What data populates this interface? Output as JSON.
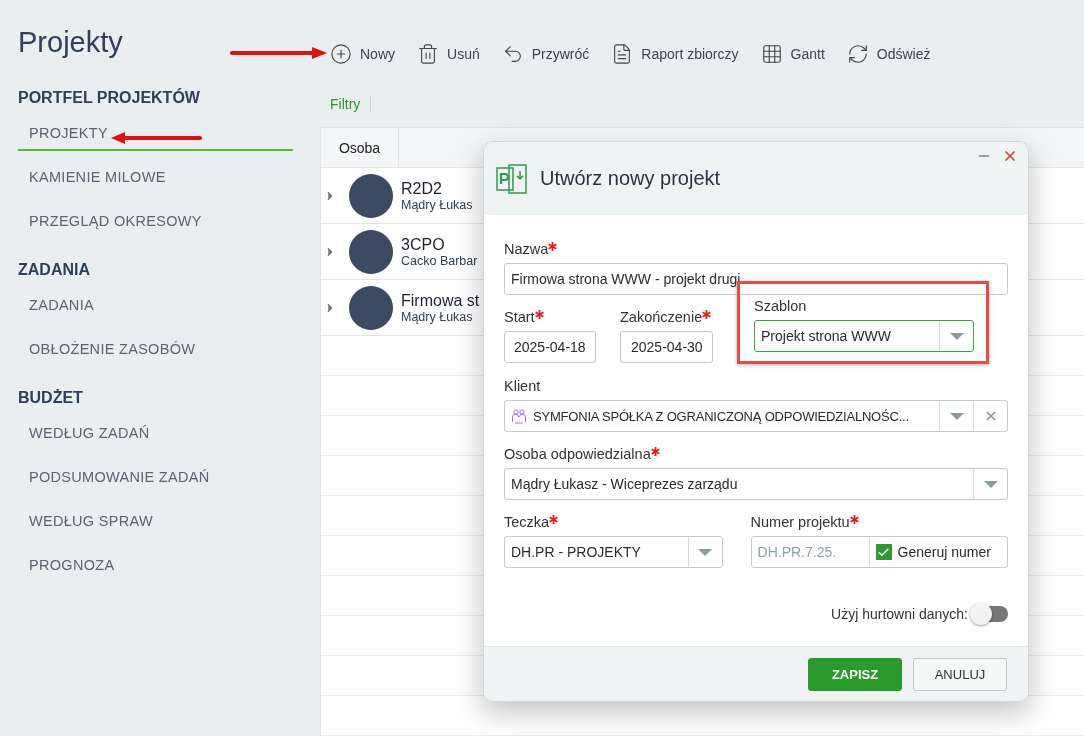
{
  "page": {
    "title": "Projekty"
  },
  "sidebar": {
    "sections": [
      {
        "heading": "PORTFEL PROJEKTÓW",
        "items": [
          {
            "label": "PROJEKTY",
            "selected": true
          },
          {
            "label": "KAMIENIE MILOWE",
            "selected": false
          },
          {
            "label": "PRZEGLĄD OKRESOWY",
            "selected": false
          }
        ]
      },
      {
        "heading": "ZADANIA",
        "items": [
          {
            "label": "ZADANIA",
            "selected": false
          },
          {
            "label": "OBŁOŻENIE ZASOBÓW",
            "selected": false
          }
        ]
      },
      {
        "heading": "BUDŻET",
        "items": [
          {
            "label": "WEDŁUG ZADAŃ",
            "selected": false
          },
          {
            "label": "PODSUMOWANIE ZADAŃ",
            "selected": false
          },
          {
            "label": "WEDŁUG SPRAW",
            "selected": false
          },
          {
            "label": "PROGNOZA",
            "selected": false
          }
        ]
      }
    ]
  },
  "toolbar": [
    {
      "kind": "add",
      "label": "Nowy"
    },
    {
      "kind": "delete",
      "label": "Usuń"
    },
    {
      "kind": "restore",
      "label": "Przywróć"
    },
    {
      "kind": "pdf",
      "label": "Raport zbiorczy"
    },
    {
      "kind": "gantt",
      "label": "Gantt"
    },
    {
      "kind": "refresh",
      "label": "Odśwież"
    }
  ],
  "filters": {
    "label": "Filtry"
  },
  "table": {
    "columns": [
      "Osoba"
    ],
    "rows": [
      {
        "title": "R2D2",
        "subtitle": "Mądry Łukas",
        "expanded": false
      },
      {
        "title": "3CPO",
        "subtitle": "Cacko Barbar",
        "expanded": false
      },
      {
        "title": "Firmowa st",
        "subtitle": "Mądry Łukas",
        "expanded": false
      }
    ]
  },
  "dialog": {
    "title": "Utwórz nowy projekt",
    "name": {
      "label": "Nazwa",
      "required": true,
      "value": "Firmowa strona WWW - projekt drugi"
    },
    "start": {
      "label": "Start",
      "required": true,
      "value": "2025-04-18"
    },
    "end": {
      "label": "Zakończenie",
      "required": true,
      "value": "2025-04-30"
    },
    "template": {
      "label": "Szablon",
      "required": false,
      "value": "Projekt strona WWW"
    },
    "client": {
      "label": "Klient",
      "required": false,
      "value": "SYMFONIA SPÓŁKA Z OGRANICZONĄ ODPOWIEDZIALNOŚC..."
    },
    "owner": {
      "label": "Osoba odpowiedzialna",
      "required": true,
      "value": "Mądry Łukasz - Wiceprezes zarządu"
    },
    "folder": {
      "label": "Teczka",
      "required": true,
      "value": "DH.PR - PROJEKTY"
    },
    "number": {
      "label": "Numer projektu",
      "required": true,
      "placeholder": "DH.PR.7.25.",
      "generate_label": "Generuj numer",
      "checked": true
    },
    "warehouse": {
      "label": "Użyj hurtowni danych:",
      "on": false
    },
    "buttons": [
      {
        "kind": "primary",
        "label": "ZAPISZ"
      },
      {
        "kind": "secondary",
        "label": "ANULUJ"
      }
    ]
  }
}
